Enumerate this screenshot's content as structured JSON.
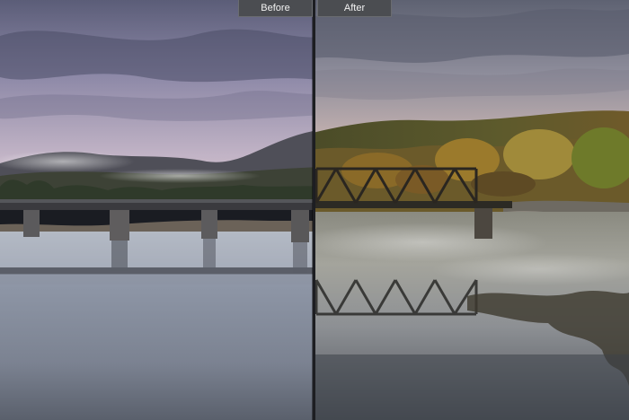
{
  "comparison": {
    "before_label": "Before",
    "after_label": "After",
    "split_position": 0.5
  },
  "scene": {
    "before_image": "before-photo",
    "after_image": "after-photo"
  }
}
